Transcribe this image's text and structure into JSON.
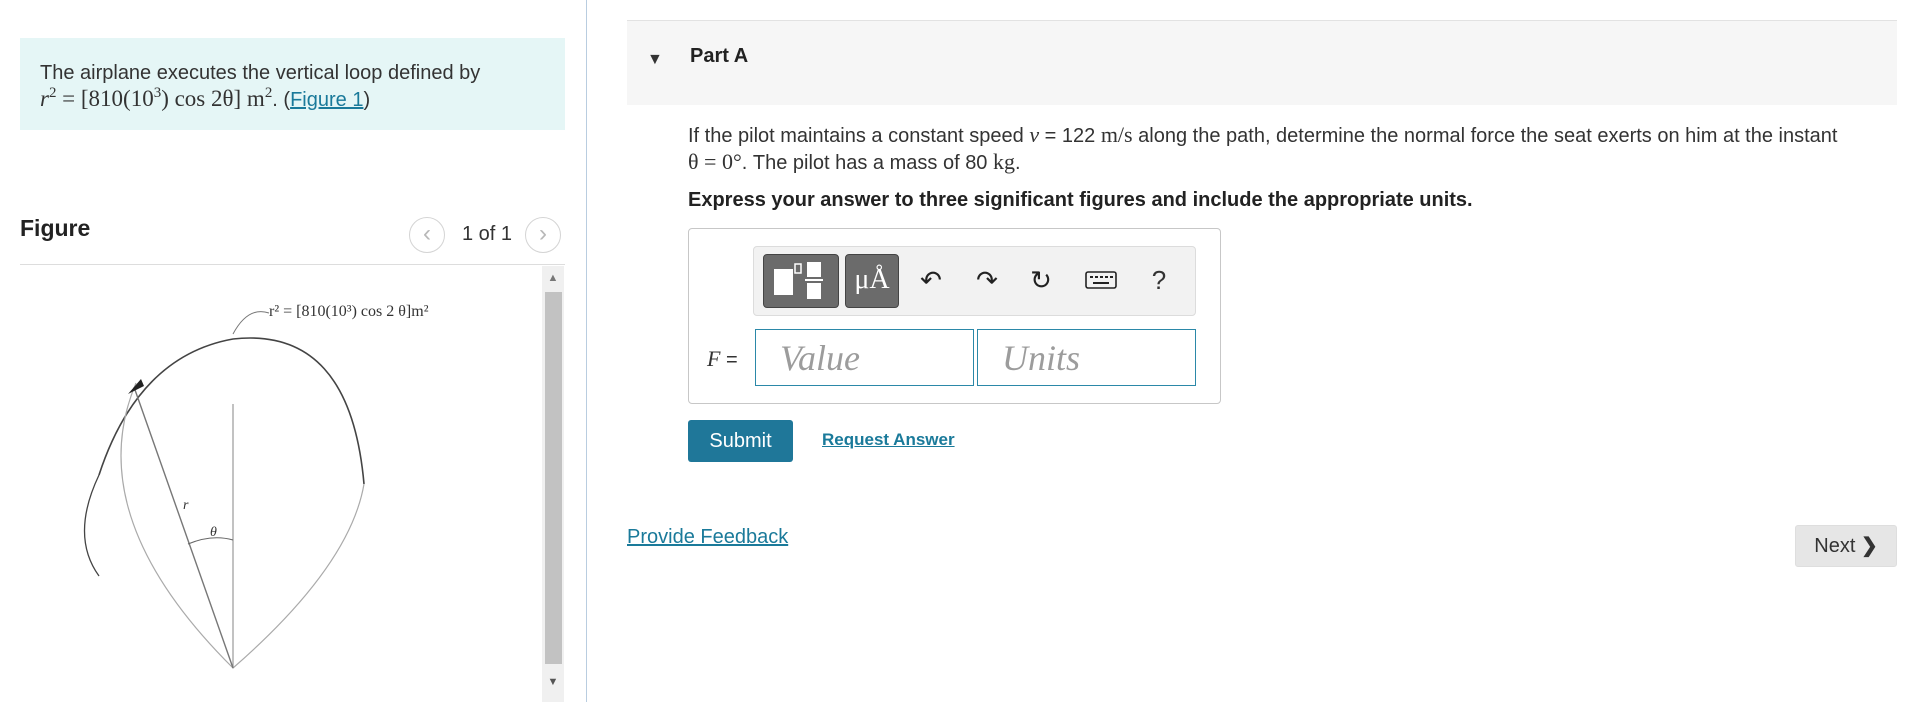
{
  "problem": {
    "text_prefix": "The airplane executes the vertical loop defined by",
    "eq_lhs": "r",
    "eq_mid": "= [810(10",
    "eq_post": ") cos 2θ] m",
    "eq_end": ". (",
    "figure_link": "Figure 1",
    "eq_close": ")"
  },
  "figure": {
    "header": "Figure",
    "counter": "1 of 1",
    "annotation": "r² = [810(10³) cos 2 θ]m²",
    "label_r": "r",
    "label_theta": "θ"
  },
  "part": {
    "title": "Part A",
    "question_pre": "If the pilot maintains a constant speed",
    "speed_var": "v",
    "speed_eq": " = 122 ",
    "speed_unit": "m/s",
    "question_mid": " along the path, determine the normal force the seat exerts on him at the instant",
    "theta_eq": "θ = 0°",
    "question_post": ". The pilot has a mass of 80",
    "mass_unit": "kg",
    "question_end": ".",
    "instruction": "Express your answer to three significant figures and include the appropriate units."
  },
  "answer": {
    "units_button": "μÅ",
    "help": "?",
    "f_label_var": "F",
    "f_label_eq": " =",
    "value_placeholder": "Value",
    "units_placeholder": "Units"
  },
  "actions": {
    "submit": "Submit",
    "request_answer": "Request Answer",
    "provide_feedback": "Provide Feedback",
    "next": "Next"
  },
  "icons": {
    "part_toggle": "caret-down-icon",
    "prev": "chevron-left-icon",
    "next": "chevron-right-icon",
    "undo": "undo-icon",
    "redo": "redo-icon",
    "reset": "reset-icon",
    "keyboard": "keyboard-icon"
  },
  "colors": {
    "accent": "#1f7799",
    "link": "#1a7a9a",
    "problem_bg": "#e5f6f6"
  }
}
